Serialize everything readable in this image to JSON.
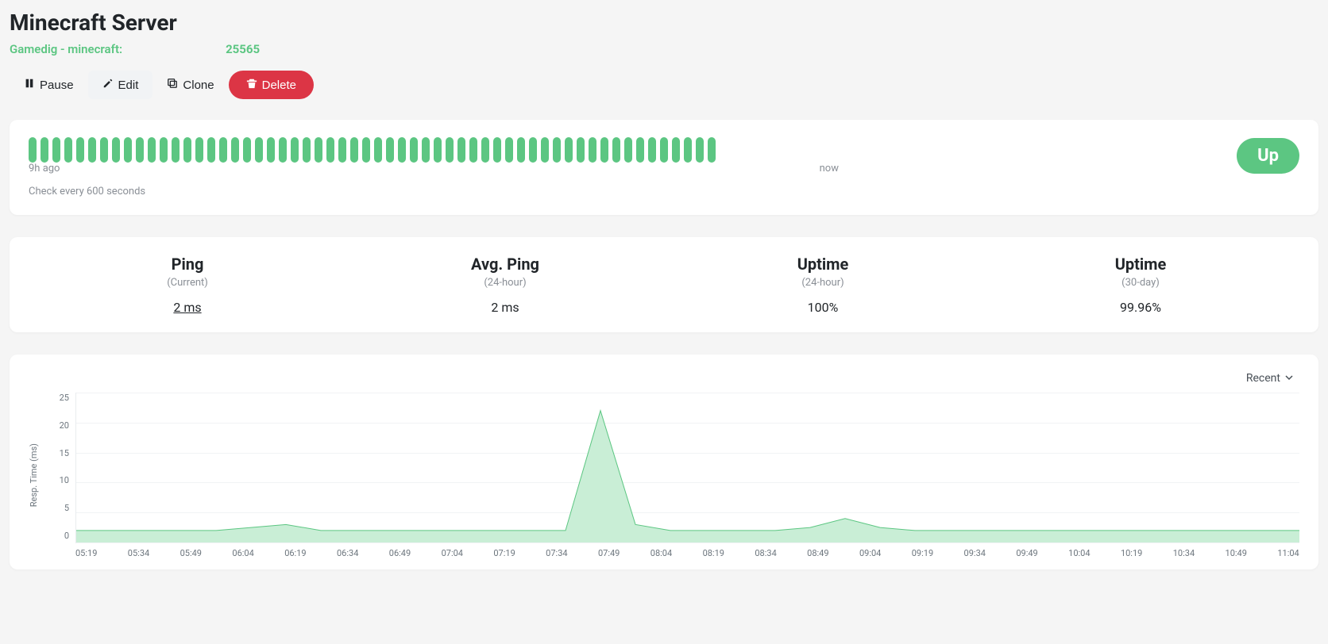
{
  "title": "Minecraft Server",
  "subtitle": {
    "label": "Gamedig - minecraft:",
    "port": "25565"
  },
  "toolbar": {
    "pause": "Pause",
    "edit": "Edit",
    "clone": "Clone",
    "delete": "Delete"
  },
  "heartbeat": {
    "count": 58,
    "left_label": "9h ago",
    "right_label": "now",
    "interval_text": "Check every 600 seconds",
    "status": "Up"
  },
  "stats": [
    {
      "title": "Ping",
      "sub": "(Current)",
      "value": "2 ms",
      "underline": true
    },
    {
      "title": "Avg. Ping",
      "sub": "(24-hour)",
      "value": "2 ms",
      "underline": false
    },
    {
      "title": "Uptime",
      "sub": "(24-hour)",
      "value": "100%",
      "underline": false
    },
    {
      "title": "Uptime",
      "sub": "(30-day)",
      "value": "99.96%",
      "underline": false
    }
  ],
  "chart": {
    "dropdown": "Recent",
    "ylabel": "Resp. Time (ms)"
  },
  "chart_data": {
    "type": "area",
    "ylabel": "Resp. Time (ms)",
    "ylim": [
      0,
      25
    ],
    "yticks": [
      0,
      5,
      10,
      15,
      20,
      25
    ],
    "categories": [
      "05:19",
      "05:34",
      "05:49",
      "06:04",
      "06:19",
      "06:34",
      "06:49",
      "07:04",
      "07:19",
      "07:34",
      "07:49",
      "08:04",
      "08:19",
      "08:34",
      "08:49",
      "09:04",
      "09:19",
      "09:34",
      "09:49",
      "10:04",
      "10:19",
      "10:34",
      "10:49",
      "11:04"
    ],
    "values": [
      2,
      2,
      2,
      2,
      2,
      2.5,
      3,
      2,
      2,
      2,
      2,
      2,
      2,
      2,
      2,
      22,
      3,
      2,
      2,
      2,
      2,
      2.5,
      4,
      2.5,
      2,
      2,
      2,
      2,
      2,
      2,
      2,
      2,
      2,
      2,
      2,
      2
    ],
    "color_fill": "#c9eed6",
    "color_stroke": "#5cc682"
  }
}
